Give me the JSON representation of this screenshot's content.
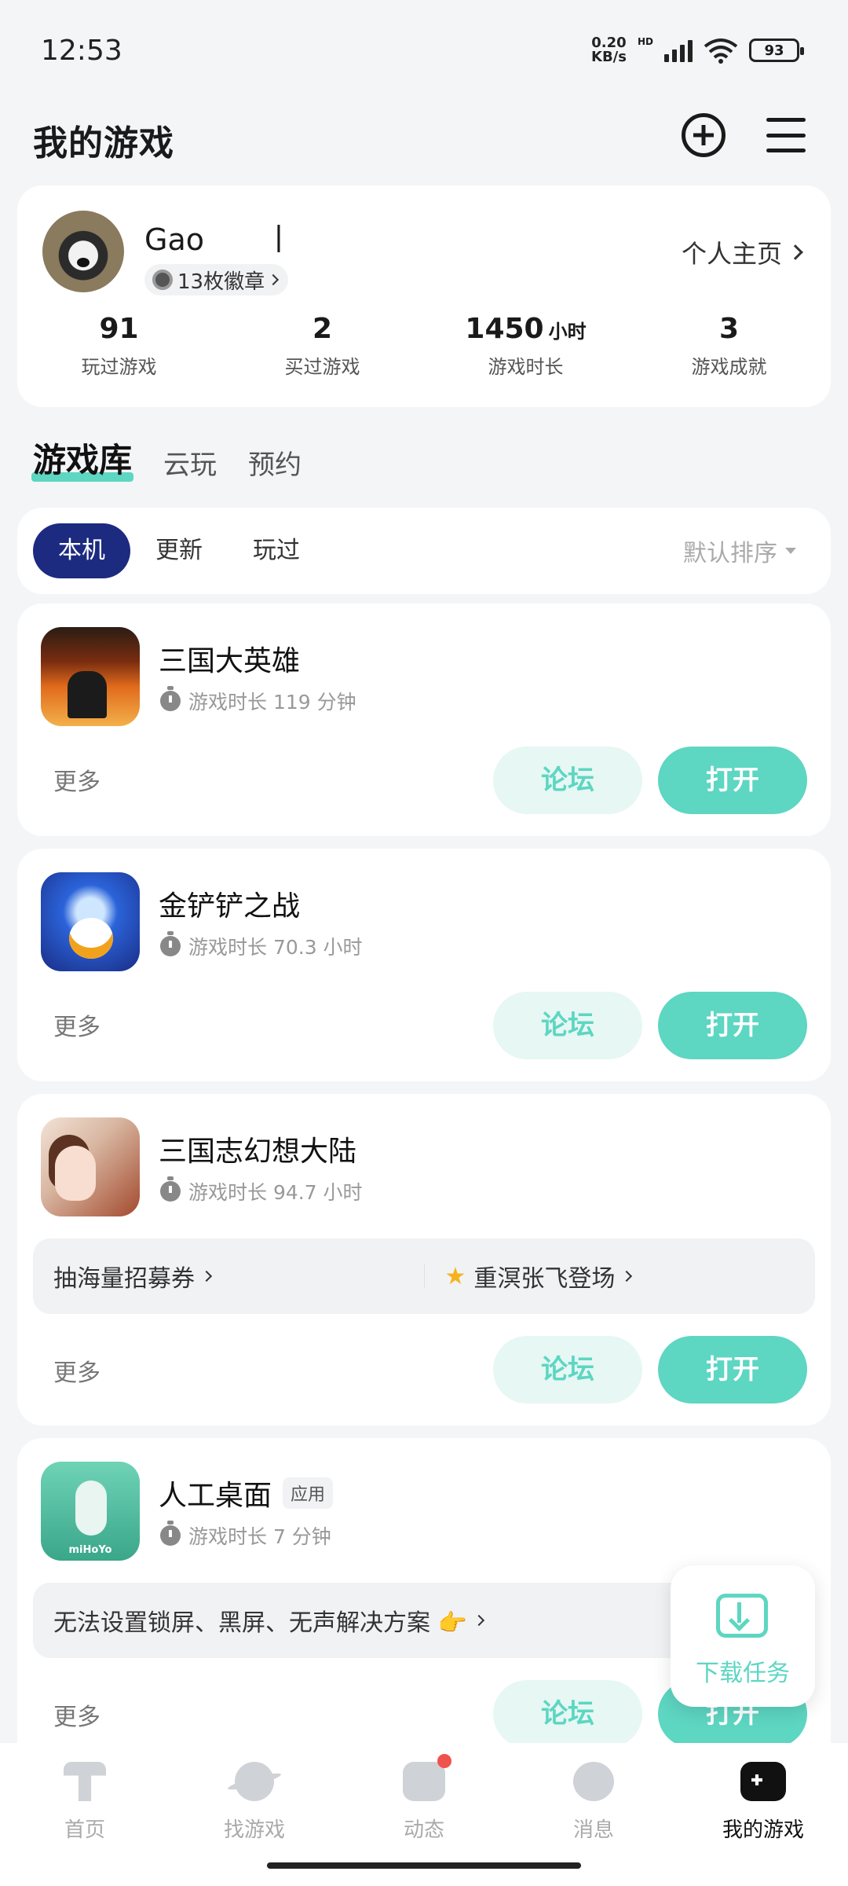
{
  "status_bar": {
    "time": "12:53",
    "net_speed_value": "0.20",
    "net_speed_unit": "KB/s",
    "network_tag": "HD",
    "battery": "93"
  },
  "header": {
    "title": "我的游戏"
  },
  "profile": {
    "username": "Gao　　丨",
    "badges": "13枚徽章",
    "home_link": "个人主页",
    "stats": [
      {
        "value": "91",
        "unit": "",
        "label": "玩过游戏"
      },
      {
        "value": "2",
        "unit": "",
        "label": "买过游戏"
      },
      {
        "value": "1450",
        "unit": "小时",
        "label": "游戏时长"
      },
      {
        "value": "3",
        "unit": "",
        "label": "游戏成就"
      }
    ]
  },
  "tabs": [
    "游戏库",
    "云玩",
    "预约"
  ],
  "filters": {
    "chips": [
      "本机",
      "更新",
      "玩过"
    ],
    "sort": "默认排序"
  },
  "games": [
    {
      "name": "三国大英雄",
      "tag": "",
      "playtime": "游戏时长 119 分钟",
      "promos": []
    },
    {
      "name": "金铲铲之战",
      "tag": "",
      "playtime": "游戏时长 70.3 小时",
      "promos": []
    },
    {
      "name": "三国志幻想大陆",
      "tag": "",
      "playtime": "游戏时长 94.7 小时",
      "promos": [
        "抽海量招募券",
        "重溟张飞登场"
      ]
    },
    {
      "name": "人工桌面",
      "tag": "应用",
      "playtime": "游戏时长 7 分钟",
      "promos": [
        "无法设置锁屏、黑屏、无声解决方案 👉"
      ]
    }
  ],
  "game_icon_label_4": "miHoYo",
  "actions": {
    "more": "更多",
    "forum": "论坛",
    "open": "打开"
  },
  "download_task": "下载任务",
  "bottom_nav": [
    "首页",
    "找游戏",
    "动态",
    "消息",
    "我的游戏"
  ],
  "colors": {
    "accent": "#5dd6c2",
    "chip_active": "#1c2a80",
    "notification_dot": "#f0524d"
  }
}
